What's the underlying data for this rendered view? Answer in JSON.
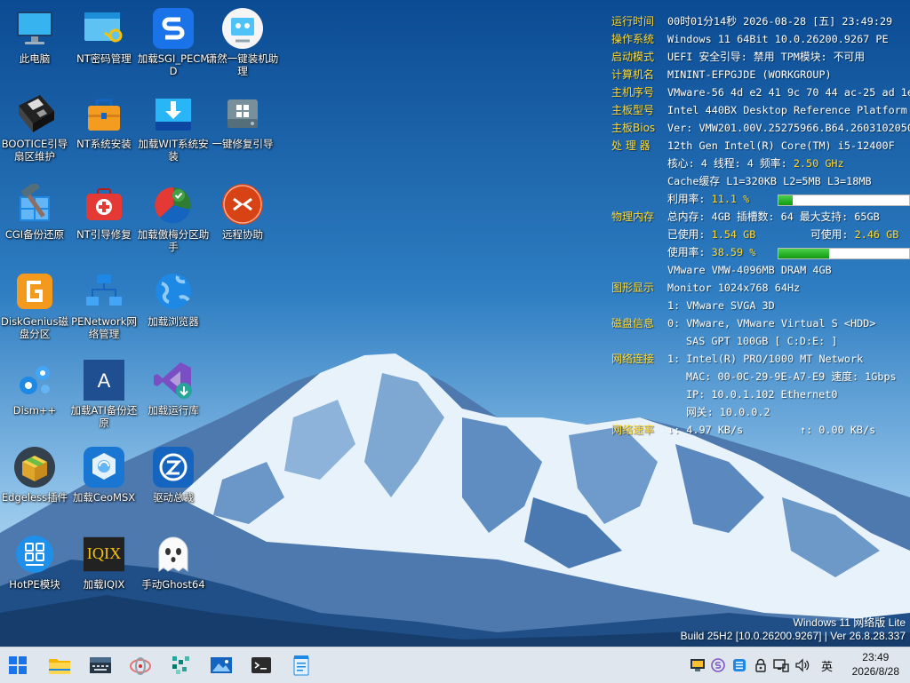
{
  "desktop": {
    "icons": [
      {
        "label": "此电脑",
        "icon": "computer-icon"
      },
      {
        "label": "NT密码管理",
        "icon": "window-key-icon"
      },
      {
        "label": "加载SGI_PECMD",
        "icon": "sgi-s-icon"
      },
      {
        "label": "潇然一键装机助理",
        "icon": "installer-assistant-icon"
      },
      {
        "label": "BOOTICE引导扇区维护",
        "icon": "floppy-disk-icon"
      },
      {
        "label": "NT系统安装",
        "icon": "toolbox-icon"
      },
      {
        "label": "加载WIT系统安装",
        "icon": "download-install-icon"
      },
      {
        "label": "一键修复引导",
        "icon": "drive-repair-icon"
      },
      {
        "label": "CGI备份还原",
        "icon": "hammer-windows-icon"
      },
      {
        "label": "NT引导修复",
        "icon": "first-aid-kit-icon"
      },
      {
        "label": "加载傲梅分区助手",
        "icon": "partition-pie-icon"
      },
      {
        "label": "远程协助",
        "icon": "remote-assist-icon"
      },
      {
        "label": "DiskGenius磁盘分区",
        "icon": "diskgenius-icon"
      },
      {
        "label": "PENetwork网络管理",
        "icon": "network-icon"
      },
      {
        "label": "加载浏览器",
        "icon": "globe-icon"
      },
      {
        "label": "Dism++",
        "icon": "gears-icon"
      },
      {
        "label": "加载ATI备份还原",
        "icon": "acronis-a-icon"
      },
      {
        "label": "加载运行库",
        "icon": "visual-studio-icon"
      },
      {
        "label": "Edgeless插件",
        "icon": "package-box-icon"
      },
      {
        "label": "加载CeoMSX",
        "icon": "ceomsx-icon"
      },
      {
        "label": "驱动总裁",
        "icon": "driver-icon"
      },
      {
        "label": "HotPE模块",
        "icon": "hpm-icon"
      },
      {
        "label": "加载IQIX",
        "icon": "iqix-icon"
      },
      {
        "label": "手动Ghost64",
        "icon": "ghost-icon"
      }
    ]
  },
  "sysinfo": {
    "runtime": {
      "key": "运行时间",
      "val": "00时01分14秒  2026-08-28 [五] 23:49:29"
    },
    "os": {
      "key": "操作系统",
      "val": "Windows 11 64Bit 10.0.26200.9267 PE"
    },
    "boot": {
      "key": "启动模式",
      "val": "UEFI   安全引导: 禁用   TPM模块: 不可用"
    },
    "computer": {
      "key": "计算机名",
      "val": "MININT-EFPGJDE (WORKGROUP)"
    },
    "serial": {
      "key": "主机序号",
      "val": "VMware-56 4d e2 41 9c 70 44 ac-25 ad 1e"
    },
    "board": {
      "key": "主板型号",
      "val": "Intel 440BX Desktop Reference Platform"
    },
    "bios": {
      "key": "主板Bios",
      "val": "Ver: VMW201.00V.25275966.B64.2603102050"
    },
    "cpu": {
      "key": "处 理 器",
      "val": "12th Gen Intel(R) Core(TM) i5-12400F",
      "cores_text": "核心: 4  线程: 4    频率:",
      "freq": "2.50 GHz",
      "cache": "Cache缓存 L1=320KB  L2=5MB  L3=18MB",
      "usage_label": "利用率:",
      "usage": "11.1 %",
      "usage_fraction": 0.111
    },
    "memory": {
      "key": "物理内存",
      "val": "总内存: 4GB  插槽数: 64  最大支持: 65GB",
      "used_label": "已使用:",
      "used": "1.54 GB",
      "avail_label": "可使用:",
      "avail": "2.46 GB",
      "usage_label": "使用率:",
      "usage": "38.59 %",
      "usage_fraction": 0.3859,
      "module": "VMware VMW-4096MB DRAM 4GB"
    },
    "display": {
      "key": "图形显示",
      "val": "Monitor 1024x768 64Hz",
      "adapter": "1: VMware SVGA 3D"
    },
    "disk": {
      "key": "磁盘信息",
      "val": "0: VMware, VMware Virtual S <HDD>",
      "detail": "SAS GPT 100GB [ C:D:E: ]"
    },
    "net": {
      "key": "网络连接",
      "val": "1: Intel(R) PRO/1000 MT Network",
      "mac": "MAC: 00-0C-29-9E-A7-E9 速度: 1Gbps",
      "ip": "IP: 10.0.1.102 Ethernet0",
      "gw": "网关: 10.0.0.2"
    },
    "speed": {
      "key": "网络速率",
      "down": "↓: 4.97 KB/s",
      "up": "↑: 0.00 KB/s"
    }
  },
  "watermark": {
    "line1": "Windows 11 网络版 Lite",
    "line2": "Build 25H2 [10.0.26200.9267] | Ver 26.8.28.337"
  },
  "taskbar": {
    "apps": [
      "start-icon",
      "file-explorer-icon",
      "keyboard-icon",
      "network-tool-icon",
      "grid-app-icon",
      "image-viewer-icon",
      "terminal-icon",
      "notepad-icon"
    ],
    "lang": "英",
    "time": "23:49",
    "date": "2026/8/28"
  },
  "colors": {
    "key": "#ffd92f",
    "bar_fill": "#18a418",
    "taskbar": "#dfe6ee"
  }
}
